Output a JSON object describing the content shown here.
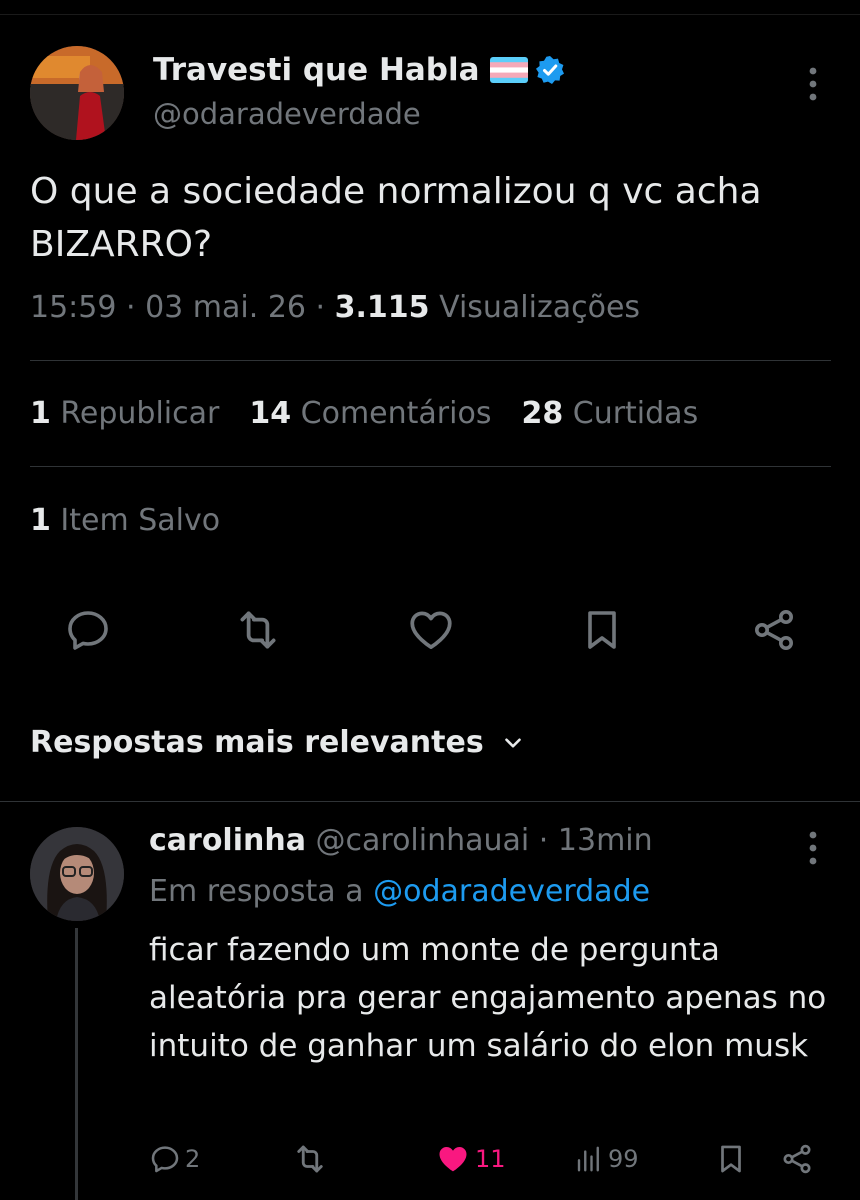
{
  "colors": {
    "background": "#000000",
    "text": "#e7e9ea",
    "muted": "#71767b",
    "link": "#1d9bf0",
    "like": "#f91880",
    "verified": "#1d9bf0"
  },
  "tweet": {
    "display_name": "Travesti que Habla",
    "flag_icon": "transgender-flag-icon",
    "verified_icon": "verified-badge-icon",
    "handle": "@odaradeverdade",
    "text": "O que a sociedade normalizou q vc acha BIZARRO?",
    "time": "15:59",
    "date": "03 mai. 26",
    "views_count": "3.115",
    "views_label": "Visualizações",
    "reposts_count": "1",
    "reposts_label": "Republicar",
    "comments_count": "14",
    "comments_label": "Comentários",
    "likes_count": "28",
    "likes_label": "Curtidas",
    "saved_count": "1",
    "saved_label": "Item Salvo"
  },
  "sort": {
    "label": "Respostas mais relevantes",
    "icon": "chevron-down-icon"
  },
  "reply": {
    "display_name": "carolinha",
    "handle": "@carolinhauai",
    "time_ago": "13min",
    "reply_prefix": "Em resposta a",
    "reply_to_handle": "@odaradeverdade",
    "text": "ficar fazendo um monte de pergunta aleatória pra gerar engajamento apenas no intuito de ganhar um salário do elon musk",
    "comments": "2",
    "likes": "11",
    "views": "99"
  }
}
